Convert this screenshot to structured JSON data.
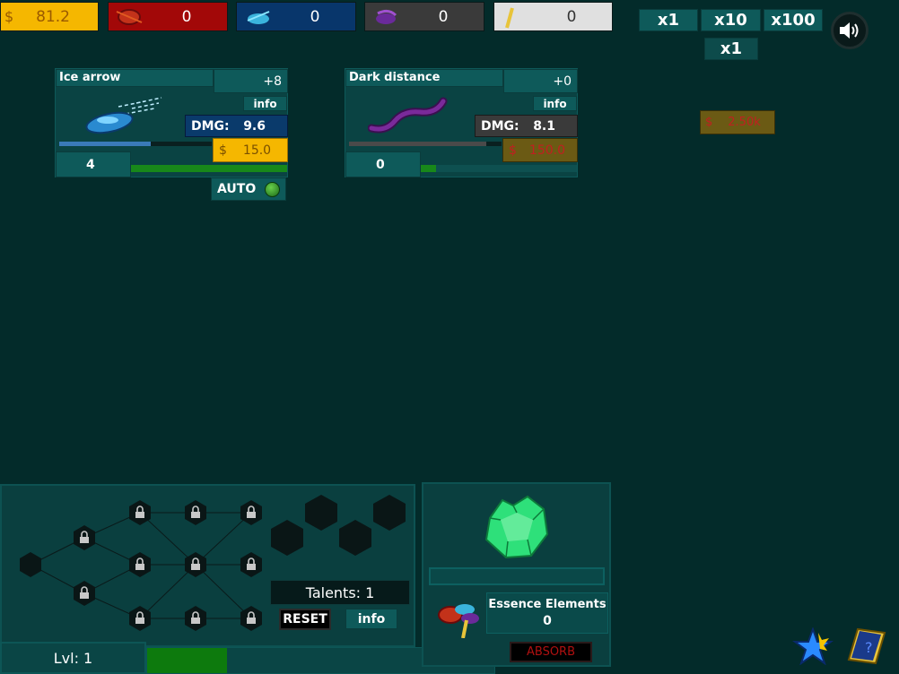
{
  "resources": {
    "gold": "81.2",
    "fire": "0",
    "ice": "0",
    "dark": "0",
    "light": "0",
    "gold_sign": "$"
  },
  "multipliers": {
    "x1": "x1",
    "x10": "x10",
    "x100": "x100",
    "current": "x1"
  },
  "cards": [
    {
      "name": "Ice arrow",
      "bonus": "+8",
      "info": "info",
      "dmg_label": "DMG:",
      "dmg": "9.6",
      "cost": "15.0",
      "count": "4",
      "progress": 0.6,
      "count_progress": 1.0,
      "auto": "AUTO"
    },
    {
      "name": "Dark distance",
      "bonus": "+0",
      "info": "info",
      "dmg_label": "DMG:",
      "dmg": "8.1",
      "cost": "150.0",
      "count": "0",
      "progress": 0.9,
      "count_progress": 0.1
    }
  ],
  "next_unlock": {
    "sign": "$",
    "cost": "2.50k"
  },
  "talents": {
    "label": "Talents: 1",
    "reset": "RESET",
    "info": "info"
  },
  "level": {
    "label": "Lvl: 1",
    "progress": 0.23
  },
  "essence": {
    "label": "Essence Elements",
    "count": "0",
    "absorb": "ABSORB"
  },
  "colors": {
    "background": "#032b2a",
    "gold": "#f5b700",
    "fire": "#a20808",
    "ice": "#08366b",
    "dark": "#3a3a3a",
    "light": "#e0e0e0",
    "teal": "#0e5a5a",
    "green": "#13a02a"
  }
}
